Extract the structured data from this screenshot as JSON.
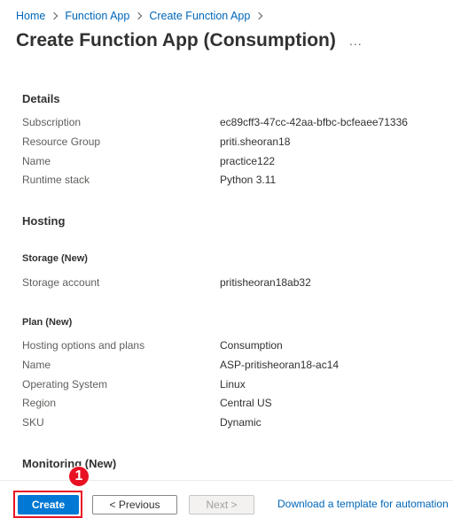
{
  "breadcrumb": [
    "Home",
    "Function App",
    "Create Function App"
  ],
  "page_title": "Create Function App (Consumption)",
  "more_icon": "...",
  "details": {
    "heading": "Details",
    "rows": [
      {
        "label": "Subscription",
        "value": "ec89cff3-47cc-42aa-bfbc-bcfeaee71336"
      },
      {
        "label": "Resource Group",
        "value": "priti.sheoran18"
      },
      {
        "label": "Name",
        "value": "practice122"
      },
      {
        "label": "Runtime stack",
        "value": "Python 3.11"
      }
    ]
  },
  "hosting": {
    "heading": "Hosting",
    "storage_heading": "Storage (New)",
    "storage_rows": [
      {
        "label": "Storage account",
        "value": "pritisheoran18ab32"
      }
    ],
    "plan_heading": "Plan (New)",
    "plan_rows": [
      {
        "label": "Hosting options and plans",
        "value": "Consumption"
      },
      {
        "label": "Name",
        "value": "ASP-pritisheoran18-ac14"
      },
      {
        "label": "Operating System",
        "value": "Linux"
      },
      {
        "label": "Region",
        "value": "Central US"
      },
      {
        "label": "SKU",
        "value": "Dynamic"
      }
    ]
  },
  "monitoring": {
    "heading": "Monitoring (New)"
  },
  "footer": {
    "create_label": "Create",
    "previous_label": "< Previous",
    "next_label": "Next >",
    "template_link": "Download a template for automation",
    "step_badge": "1"
  },
  "colors": {
    "accent": "#0078d4",
    "link": "#0066b8",
    "highlight": "#e81123"
  }
}
